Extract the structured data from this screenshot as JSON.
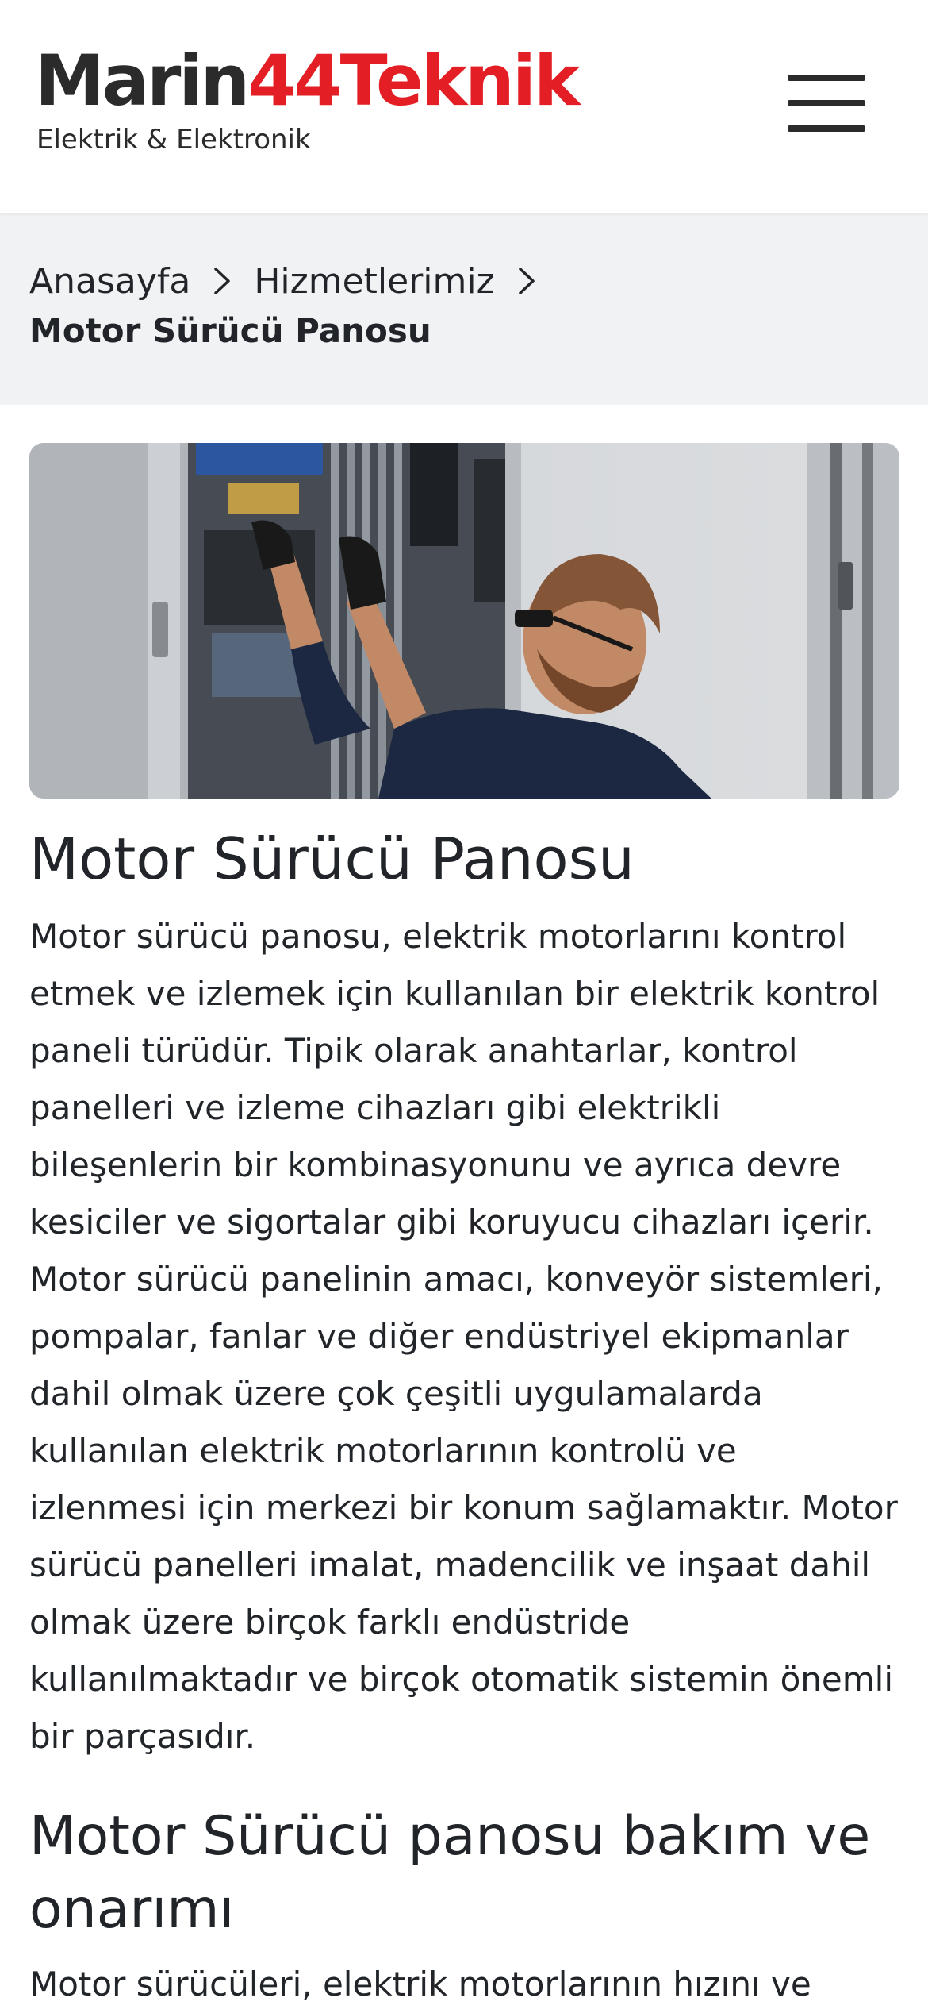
{
  "colors": {
    "brand_dark": "#2b2b2b",
    "brand_red": "#e31e24",
    "breadcrumb_bg": "#f1f2f4",
    "text": "#212529"
  },
  "header": {
    "logo_part1": "Marin",
    "logo_part2": "44Teknik",
    "logo_tagline": "Elektrik & Elektronik",
    "menu_icon": "hamburger-menu-icon"
  },
  "breadcrumb": {
    "home": "Anasayfa",
    "services": "Hizmetlerimiz",
    "current": "Motor Sürücü Panosu",
    "separator_icon": "chevron-right-icon"
  },
  "hero_image": {
    "icon": "technician-electrical-panel-photo"
  },
  "main": {
    "title": "Motor Sürücü Panosu",
    "paragraph": "Motor sürücü panosu, elektrik motorlarını kontrol etmek ve izlemek için kullanılan bir elektrik kontrol paneli türüdür. Tipik olarak anahtarlar, kontrol panelleri ve izleme cihazları gibi elektrikli bileşenlerin bir kombinasyonunu ve ayrıca devre kesiciler ve sigortalar gibi koruyucu cihazları içerir. Motor sürücü panelinin amacı, konveyör sistemleri, pompalar, fanlar ve diğer endüstriyel ekipmanlar dahil olmak üzere çok çeşitli uygulamalarda kullanılan elektrik motorlarının kontrolü ve izlenmesi için merkezi bir konum sağlamaktır. Motor sürücü panelleri imalat, madencilik ve inşaat dahil olmak üzere birçok farklı endüstride kullanılmaktadır ve birçok otomatik sistemin önemli bir parçasıdır.",
    "subtitle": "Motor Sürücü panosu bakım ve onarımı",
    "paragraph2_partial": "Motor sürücüleri, elektrik motorlarının hızını ve"
  }
}
